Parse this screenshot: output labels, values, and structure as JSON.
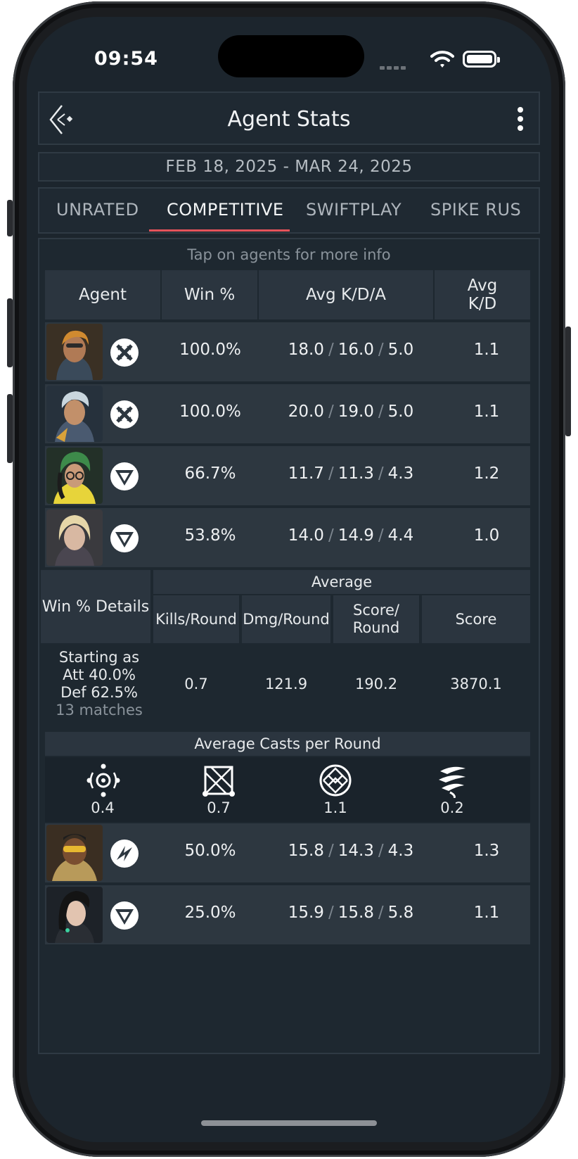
{
  "status": {
    "time": "09:54"
  },
  "header": {
    "title": "Agent Stats"
  },
  "date_range": "FEB 18, 2025 - MAR 24, 2025",
  "tabs": [
    {
      "label": "UNRATED",
      "active": false
    },
    {
      "label": "COMPETITIVE",
      "active": true
    },
    {
      "label": "SWIFTPLAY",
      "active": false
    },
    {
      "label": "SPIKE RUS",
      "active": false
    }
  ],
  "hint": "Tap on agents for more info",
  "columns": {
    "agent": "Agent",
    "win": "Win %",
    "kda": "Avg K/D/A",
    "kd_line1": "Avg",
    "kd_line2": "K/D"
  },
  "agents_top": [
    {
      "role_icon": "duelist-icon",
      "win": "100.0%",
      "k": "18.0",
      "d": "16.0",
      "a": "5.0",
      "kd": "1.1"
    },
    {
      "role_icon": "duelist-icon",
      "win": "100.0%",
      "k": "20.0",
      "d": "19.0",
      "a": "5.0",
      "kd": "1.1"
    },
    {
      "role_icon": "sentinel-icon",
      "win": "66.7%",
      "k": "11.7",
      "d": "11.3",
      "a": "4.3",
      "kd": "1.2"
    },
    {
      "role_icon": "sentinel-icon",
      "win": "53.8%",
      "k": "14.0",
      "d": "14.9",
      "a": "4.4",
      "kd": "1.0"
    }
  ],
  "details": {
    "header": "Win % Details",
    "average": "Average",
    "col_kills": "Kills/Round",
    "col_dmg": "Dmg/Round",
    "col_score_round_1": "Score/",
    "col_score_round_2": "Round",
    "col_score": "Score",
    "starting_as": "Starting as",
    "att": "Att 40.0%",
    "def": "Def 62.5%",
    "matches": "13 matches",
    "kills_round": "0.7",
    "dmg_round": "121.9",
    "score_round": "190.2",
    "score": "3870.1"
  },
  "casts": {
    "title": "Average Casts per Round",
    "items": [
      {
        "icon": "ability-orb-icon",
        "value": "0.4"
      },
      {
        "icon": "ability-grid-icon",
        "value": "0.7"
      },
      {
        "icon": "ability-lattice-icon",
        "value": "1.1"
      },
      {
        "icon": "ability-swirl-icon",
        "value": "0.2"
      }
    ]
  },
  "agents_bottom": [
    {
      "role_icon": "initiator-icon",
      "win": "50.0%",
      "k": "15.8",
      "d": "14.3",
      "a": "4.3",
      "kd": "1.3"
    },
    {
      "role_icon": "sentinel-icon",
      "win": "25.0%",
      "k": "15.9",
      "d": "15.8",
      "a": "5.8",
      "kd": "1.1"
    }
  ],
  "colors": {
    "accent": "#e4535a",
    "bg": "#1c252d",
    "row": "#2d3740"
  }
}
